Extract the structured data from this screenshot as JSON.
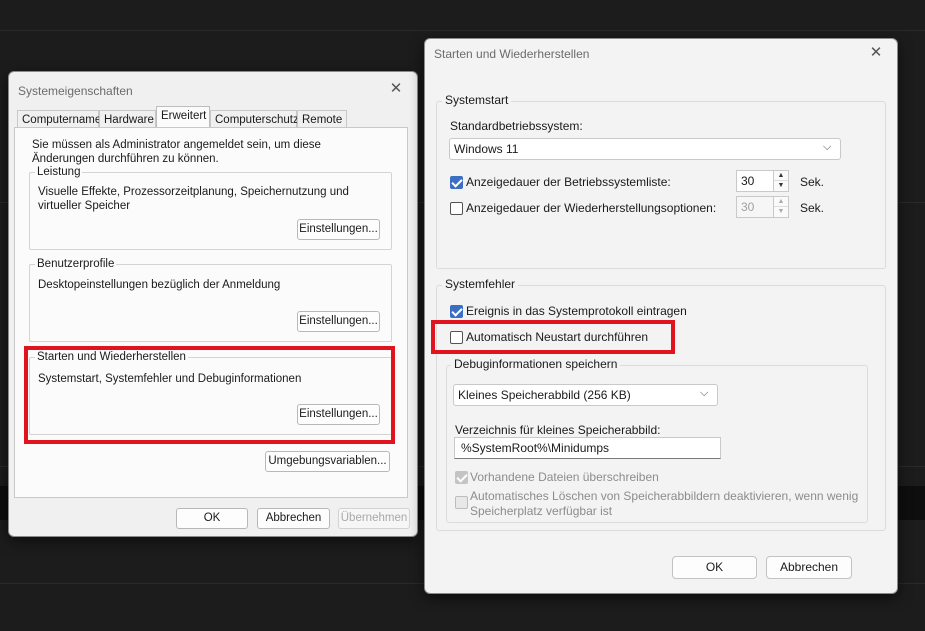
{
  "colors": {
    "highlight": "#e0141e",
    "checkbox_accent": "#3a6fc4"
  },
  "left_dialog": {
    "title": "Systemeigenschaften",
    "close_icon": "close-icon",
    "tabs": [
      {
        "label": "Computername"
      },
      {
        "label": "Hardware"
      },
      {
        "label": "Erweitert",
        "active": true
      },
      {
        "label": "Computerschutz"
      },
      {
        "label": "Remote"
      }
    ],
    "admin_notice": "Sie müssen als Administrator angemeldet sein, um diese Änderungen durchführen zu können.",
    "groups": {
      "performance": {
        "title": "Leistung",
        "description": "Visuelle Effekte, Prozessorzeitplanung, Speichernutzung und virtueller Speicher",
        "button": "Einstellungen..."
      },
      "profiles": {
        "title": "Benutzerprofile",
        "description": "Desktopeinstellungen bezüglich der Anmeldung",
        "button": "Einstellungen..."
      },
      "startup": {
        "title": "Starten und Wiederherstellen",
        "description": "Systemstart, Systemfehler und Debuginformationen",
        "button": "Einstellungen..."
      }
    },
    "env_button": "Umgebungsvariablen...",
    "footer": {
      "ok": "OK",
      "cancel": "Abbrechen",
      "apply": "Übernehmen"
    }
  },
  "right_dialog": {
    "title": "Starten und Wiederherstellen",
    "close_icon": "close-icon",
    "systemstart": {
      "title": "Systemstart",
      "default_os_label": "Standardbetriebssystem:",
      "default_os_value": "Windows 11",
      "show_os_list": {
        "label": "Anzeigedauer der Betriebssystemliste:",
        "checked": true,
        "value": "30",
        "unit": "Sek."
      },
      "show_recovery": {
        "label": "Anzeigedauer der Wiederherstellungsoptionen:",
        "checked": false,
        "value": "30",
        "unit": "Sek."
      }
    },
    "systemfehler": {
      "title": "Systemfehler",
      "log_event": {
        "label": "Ereignis in das Systemprotokoll eintragen",
        "checked": true
      },
      "auto_restart": {
        "label": "Automatisch Neustart durchführen",
        "checked": false
      },
      "debug": {
        "title": "Debuginformationen speichern",
        "dump_type": "Kleines Speicherabbild (256 KB)",
        "dir_label": "Verzeichnis für kleines Speicherabbild:",
        "dir_value": "%SystemRoot%\\Minidumps",
        "overwrite": {
          "label": "Vorhandene Dateien überschreiben",
          "checked": true,
          "disabled": true
        },
        "disable_auto_delete": {
          "label": "Automatisches Löschen von Speicherabbildern deaktivieren, wenn wenig Speicherplatz verfügbar ist",
          "checked": false,
          "disabled": true
        }
      }
    },
    "footer": {
      "ok": "OK",
      "cancel": "Abbrechen"
    }
  }
}
